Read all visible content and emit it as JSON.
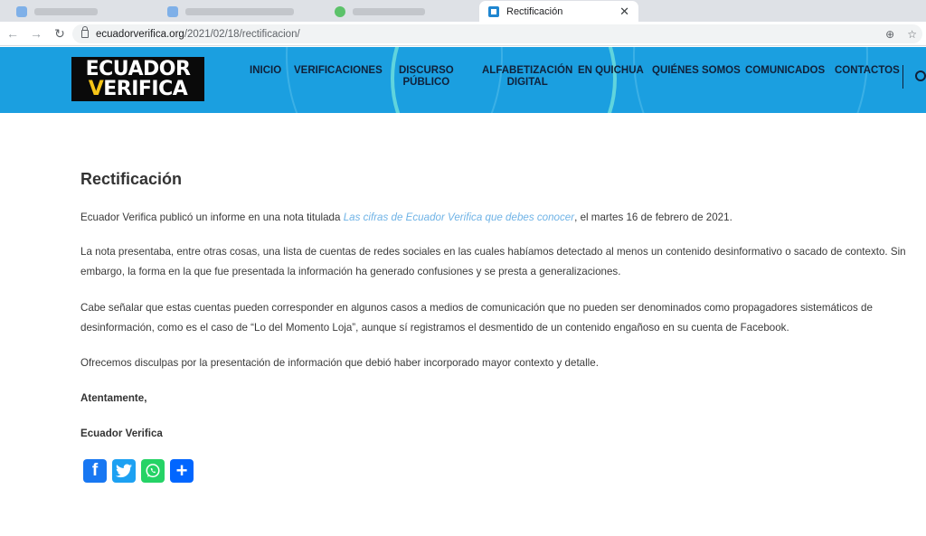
{
  "browser": {
    "active_tab": {
      "title": "Rectificación"
    },
    "url_host": "ecuadorverifica.org",
    "url_path": "/2021/02/18/rectificacion/"
  },
  "site": {
    "logo_line1": "ECUADOR",
    "logo_line2_v": "V",
    "logo_line2_rest": "ERIFICA",
    "nav": [
      {
        "label": "INICIO"
      },
      {
        "label": "VERIFICACIONES"
      },
      {
        "label": "DISCURSO\nPÚBLICO"
      },
      {
        "label": "ALFABETIZACIÓN\nDIGITAL"
      },
      {
        "label": "EN QUICHUA"
      },
      {
        "label": "QUIÉNES SOMOS"
      },
      {
        "label": "COMUNICADOS"
      },
      {
        "label": "CONTACTOS"
      }
    ]
  },
  "article": {
    "title": "Rectificación",
    "p1_before": "Ecuador Verifica publicó un informe en una nota titulada ",
    "p1_link": "Las cifras de Ecuador Verifica que debes conocer",
    "p1_after": ", el martes 16 de febrero de 2021.",
    "p2": "La nota presentaba, entre otras cosas, una lista de cuentas de redes sociales en las cuales habíamos detectado al menos un contenido desinformativo o sacado de contexto. Sin embargo, la forma en la que fue presentada la información ha generado confusiones y se presta a generalizaciones.",
    "p3": "Cabe señalar que estas cuentas pueden corresponder en algunos casos a medios de comunicación que no pueden ser denominados como propagadores sistemáticos de desinformación, como es el caso de “Lo del Momento Loja”, aunque sí registramos el desmentido de un contenido engañoso en su cuenta de Facebook.",
    "p4": "Ofrecemos disculpas por la presentación de información que debió haber incorporado mayor contexto y detalle.",
    "closing": "Atentamente,",
    "signature": "Ecuador Verifica"
  },
  "share": {
    "facebook_glyph": "f",
    "share_glyph": "+"
  },
  "colors": {
    "header_bg": "#1b9fe0",
    "link": "#6fb3e6"
  }
}
